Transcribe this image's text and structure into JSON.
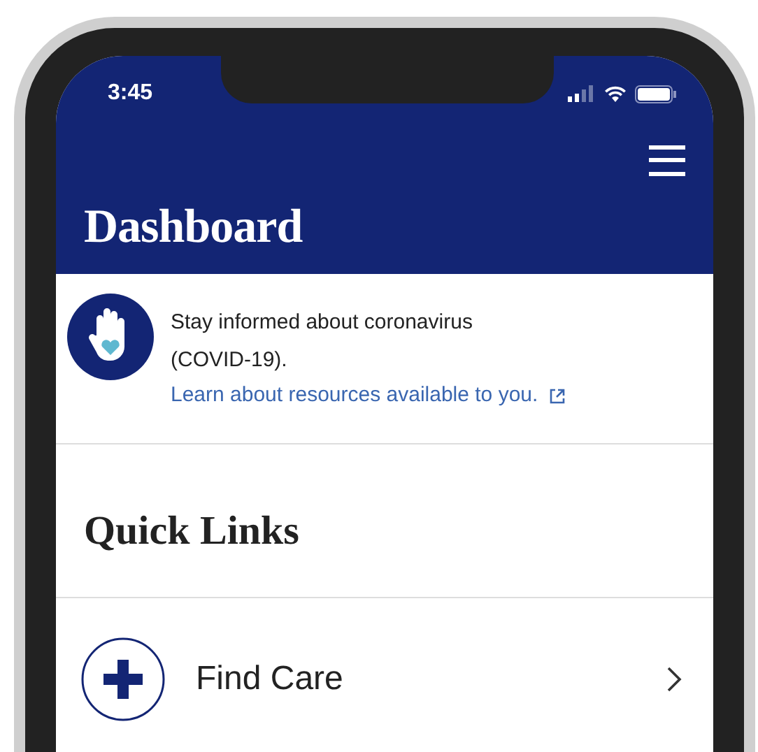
{
  "status_bar": {
    "time": "3:45"
  },
  "header": {
    "title": "Dashboard"
  },
  "banner": {
    "text": "Stay informed about coronavirus (COVID-19).",
    "link": "Learn about resources available to you."
  },
  "quick_links": {
    "heading": "Quick Links",
    "items": [
      {
        "label": "Find Care"
      }
    ]
  }
}
